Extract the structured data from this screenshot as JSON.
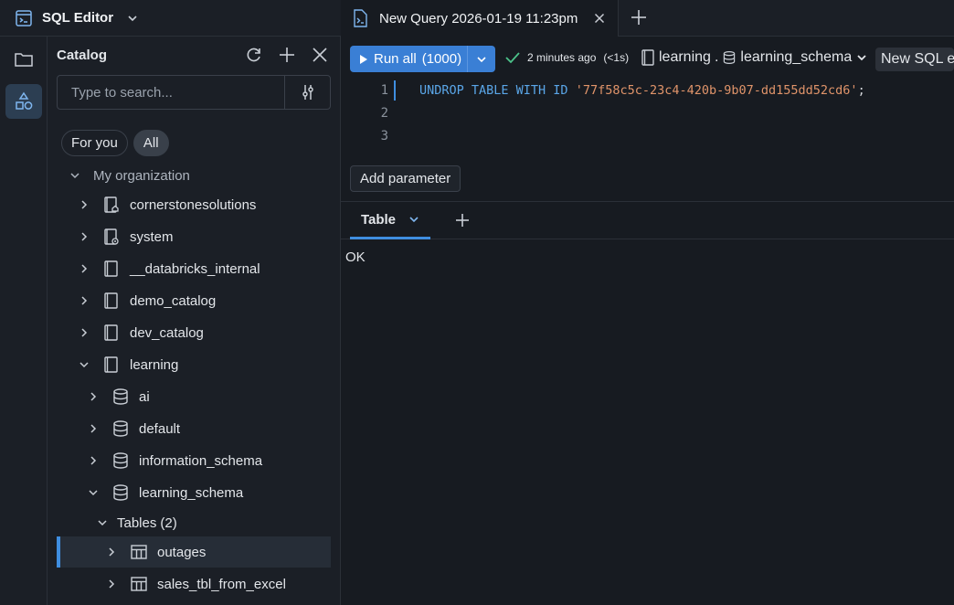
{
  "app": {
    "title": "SQL Editor"
  },
  "catalog": {
    "title": "Catalog",
    "search_placeholder": "Type to search...",
    "pills": [
      {
        "label": "For you"
      },
      {
        "label": "All"
      }
    ],
    "org_label": "My organization",
    "catalogs": [
      {
        "name": "cornerstonesolutions"
      },
      {
        "name": "system"
      },
      {
        "name": "__databricks_internal"
      },
      {
        "name": "demo_catalog"
      },
      {
        "name": "dev_catalog"
      },
      {
        "name": "learning"
      }
    ],
    "schemas": [
      {
        "name": "ai"
      },
      {
        "name": "default"
      },
      {
        "name": "information_schema"
      },
      {
        "name": "learning_schema"
      }
    ],
    "tables_group": {
      "label": "Tables",
      "count": "(2)"
    },
    "tables": [
      {
        "name": "outages"
      },
      {
        "name": "sales_tbl_from_excel"
      }
    ]
  },
  "tabs": {
    "query_tab_label": "New Query 2026-01-19 11:23pm"
  },
  "toolbar": {
    "run_label": "Run all",
    "run_limit": "(1000)",
    "status_text": "2 minutes ago",
    "status_duration": "(<1s)",
    "context_catalog": "learning",
    "context_sep": ".",
    "context_schema": "learning_schema",
    "new_sql_label": "New SQL editor"
  },
  "editor": {
    "line_numbers": [
      "1",
      "2",
      "3"
    ],
    "code_keywords": "UNDROP TABLE WITH ID",
    "code_string": "'77f58c5c-23c4-420b-9b07-dd155dd52cd6'",
    "code_end": ";"
  },
  "params": {
    "add_label": "Add parameter"
  },
  "results": {
    "tab_label": "Table",
    "output": "OK"
  },
  "colors": {
    "accent": "#3a7fd5",
    "background": "#171b21",
    "panel": "#1b1f26"
  }
}
